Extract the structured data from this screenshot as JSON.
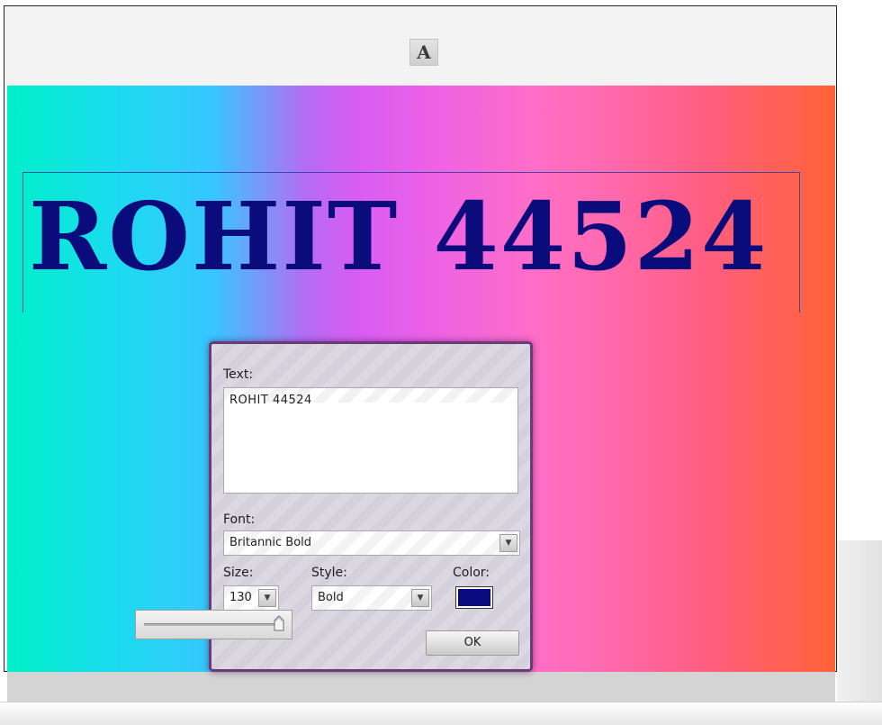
{
  "toolbar": {
    "text_tool_label": "A"
  },
  "canvas": {
    "rendered_text": "ROHIT 44524",
    "text_color": "#090c7a"
  },
  "text_dialog": {
    "text_label": "Text:",
    "text_value": "ROHIT 44524",
    "font_label": "Font:",
    "font_value": "Britannic Bold",
    "size_label": "Size:",
    "size_value": "130",
    "style_label": "Style:",
    "style_value": "Bold",
    "color_label": "Color:",
    "color_value": "#0b0b80",
    "ok_label": "OK"
  },
  "size_slider": {
    "level": 1.0
  }
}
